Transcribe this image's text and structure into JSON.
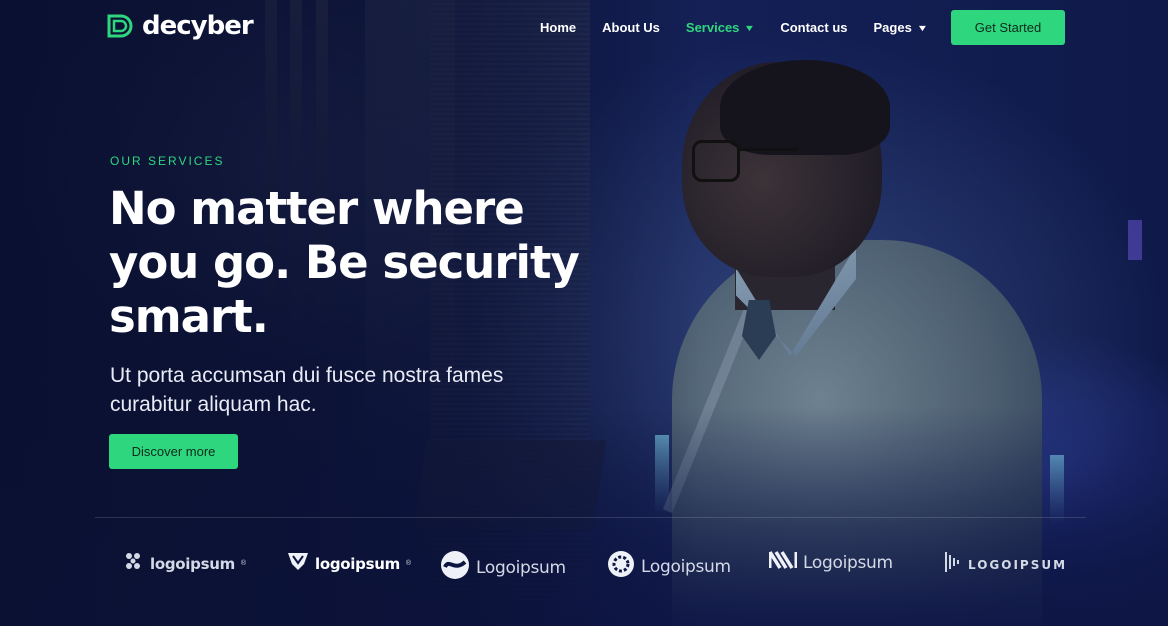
{
  "header": {
    "brand": "decyber",
    "nav": [
      {
        "label": "Home",
        "active": false,
        "dropdown": false
      },
      {
        "label": "About Us",
        "active": false,
        "dropdown": false
      },
      {
        "label": "Services",
        "active": true,
        "dropdown": true
      },
      {
        "label": "Contact us",
        "active": false,
        "dropdown": false
      },
      {
        "label": "Pages",
        "active": false,
        "dropdown": true
      }
    ],
    "cta_label": "Get Started"
  },
  "hero": {
    "eyebrow": "OUR SERVICES",
    "headline": "No matter where you go. Be security smart.",
    "subtitle": "Ut porta accumsan dui fusce nostra fames curabitur aliquam hac.",
    "button_label": "Discover more"
  },
  "partners": [
    {
      "name": "logoipsum",
      "icon": "cluster-icon"
    },
    {
      "name": "logoipsum",
      "icon": "shield-icon"
    },
    {
      "name": "Logoipsum",
      "icon": "wave-circle-icon"
    },
    {
      "name": "Logoipsum",
      "icon": "gear-circle-icon"
    },
    {
      "name": "Logoipsum",
      "icon": "n-stripes-icon"
    },
    {
      "name": "LOGOIPSUM",
      "icon": "bars-icon"
    }
  ],
  "colors": {
    "accent": "#2ed67d",
    "background": "#0d1640"
  }
}
